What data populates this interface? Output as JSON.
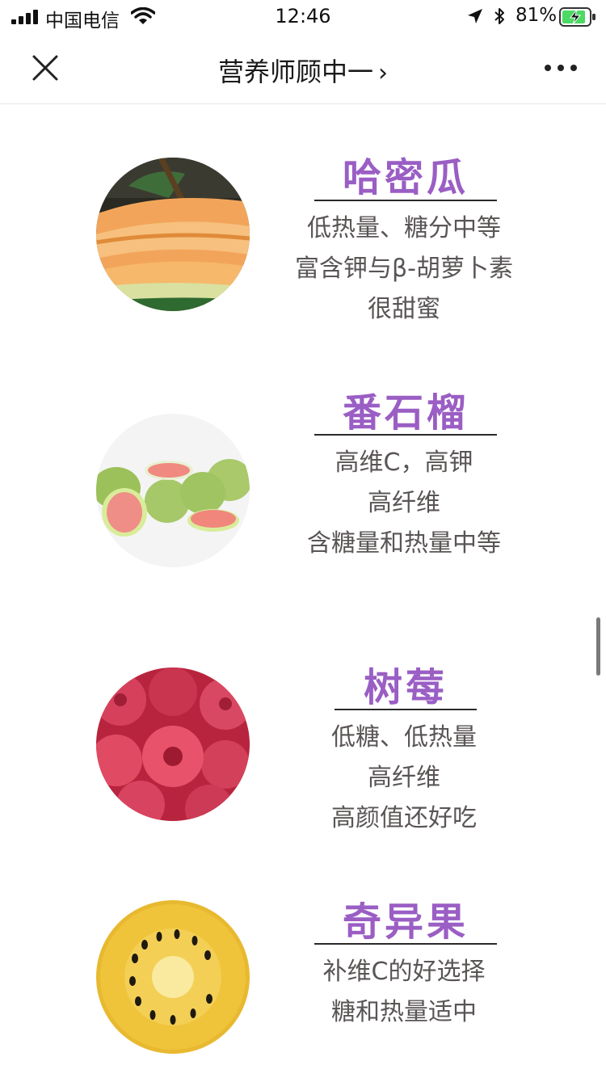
{
  "status_bar": {
    "carrier": "中国电信",
    "time": "12:46",
    "battery": "81%"
  },
  "nav": {
    "title": "营养师顾中一",
    "chevron": "›",
    "close_icon": "close-icon",
    "more_icon": "more-icon"
  },
  "fruits": [
    {
      "name": "哈密瓜",
      "lines": [
        "低热量、糖分中等",
        "富含钾与β-胡萝卜素",
        "很甜蜜"
      ]
    },
    {
      "name": "番石榴",
      "lines": [
        "高维C，高钾",
        "高纤维",
        "含糖量和热量中等"
      ]
    },
    {
      "name": "树莓",
      "lines": [
        "低糖、低热量",
        "高纤维",
        "高颜值还好吃"
      ]
    },
    {
      "name": "奇异果",
      "lines": [
        "补维C的好选择",
        "糖和热量适中"
      ]
    }
  ],
  "colors": {
    "accent": "#9a5ec4",
    "text": "#5a5555"
  }
}
